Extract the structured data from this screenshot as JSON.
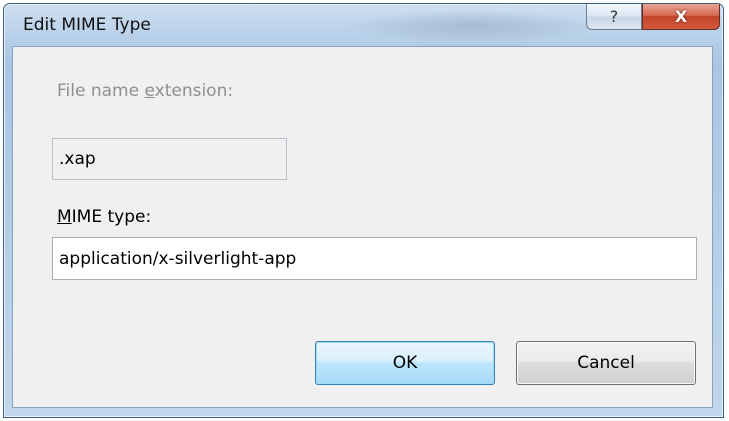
{
  "window": {
    "title": "Edit MIME Type"
  },
  "titlebar_buttons": {
    "help": "?",
    "close": "X"
  },
  "fields": {
    "extension": {
      "label_before": "File name ",
      "label_accel": "e",
      "label_after": "xtension:",
      "value": ".xap",
      "enabled": false
    },
    "mime_type": {
      "label_accel": "M",
      "label_after": "IME type:",
      "value": "application/x-silverlight-app",
      "enabled": true
    }
  },
  "buttons": {
    "ok": "OK",
    "cancel": "Cancel"
  },
  "icons": {
    "help": "question-mark-icon",
    "close": "close-x-icon"
  },
  "colors": {
    "title_frame": "#bcd3ea",
    "close_button": "#c2442b",
    "ok_button_border": "#3c7fb1",
    "dialog_body": "#f0f0f0",
    "disabled_text": "#8f8f8f"
  }
}
